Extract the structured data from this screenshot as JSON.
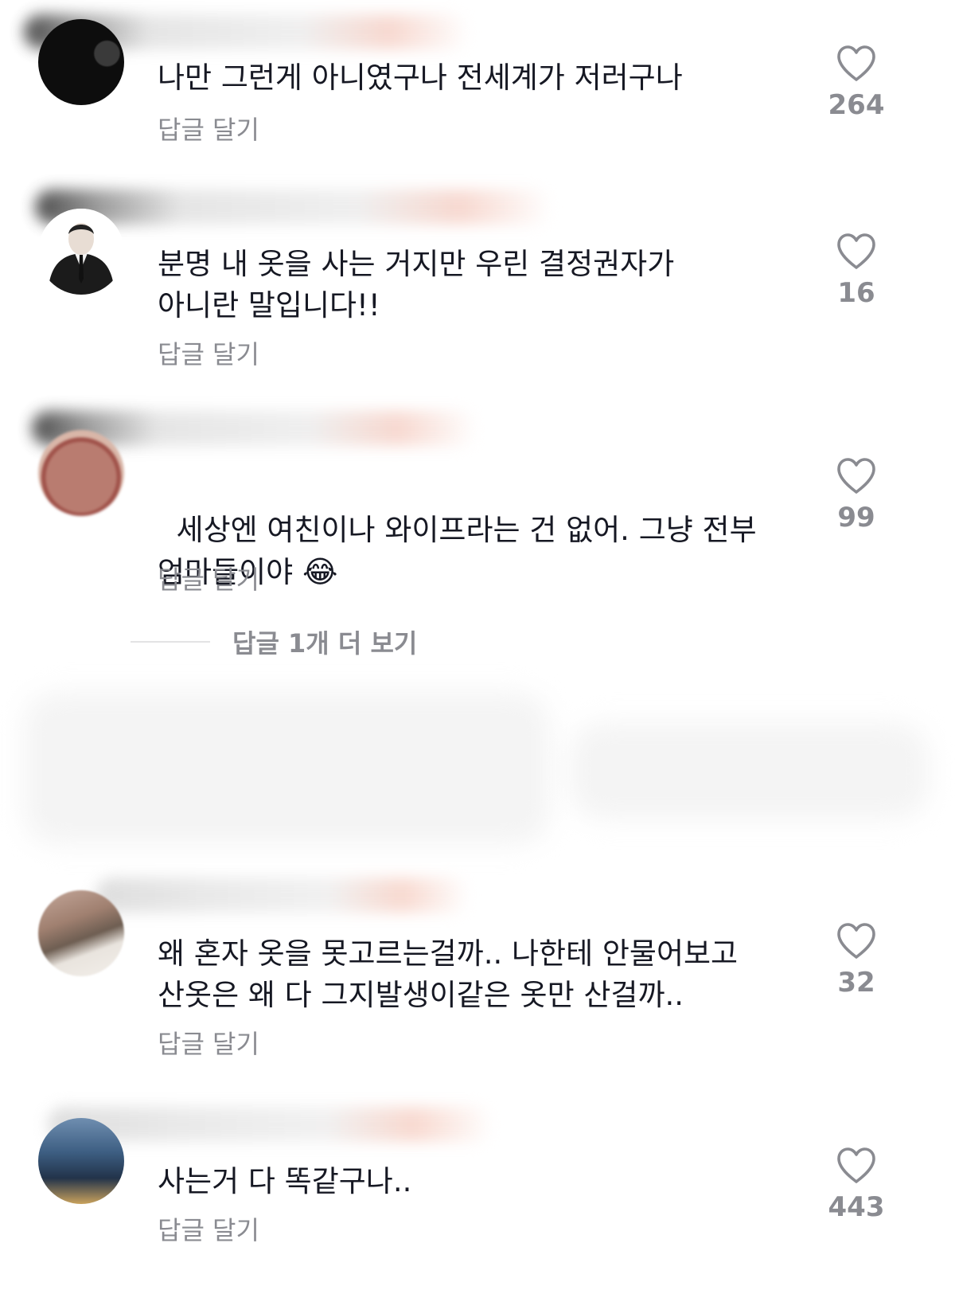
{
  "comments": [
    {
      "text": "나만 그런게 아니였구나 전세계가 저러구나",
      "reply_label": "답글 달기",
      "likes": "264"
    },
    {
      "text": "분명 내 옷을 사는 거지만 우린 결정권자가\n아니란 말입니다!!",
      "reply_label": "답글 달기",
      "likes": "16"
    },
    {
      "text": "세상엔 여친이나 와이프라는 건 없어. 그냥 전부\n엄마들이야 ",
      "emoji": "😂",
      "reply_label": "답글 달기",
      "likes": "99"
    },
    {
      "text": "왜 혼자 옷을 못고르는걸까.. 나한테 안물어보고\n산옷은 왜 다 그지발생이같은 옷만 산걸까..",
      "reply_label": "답글 달기",
      "likes": "32"
    },
    {
      "text": "사는거 다 똑같구나..",
      "reply_label": "답글 달기",
      "likes": "443"
    }
  ],
  "more_replies_label": "답글 1개 더 보기",
  "colors": {
    "text": "#161823",
    "secondary": "#8a8b91"
  },
  "icons": {
    "like": "heart-icon"
  }
}
